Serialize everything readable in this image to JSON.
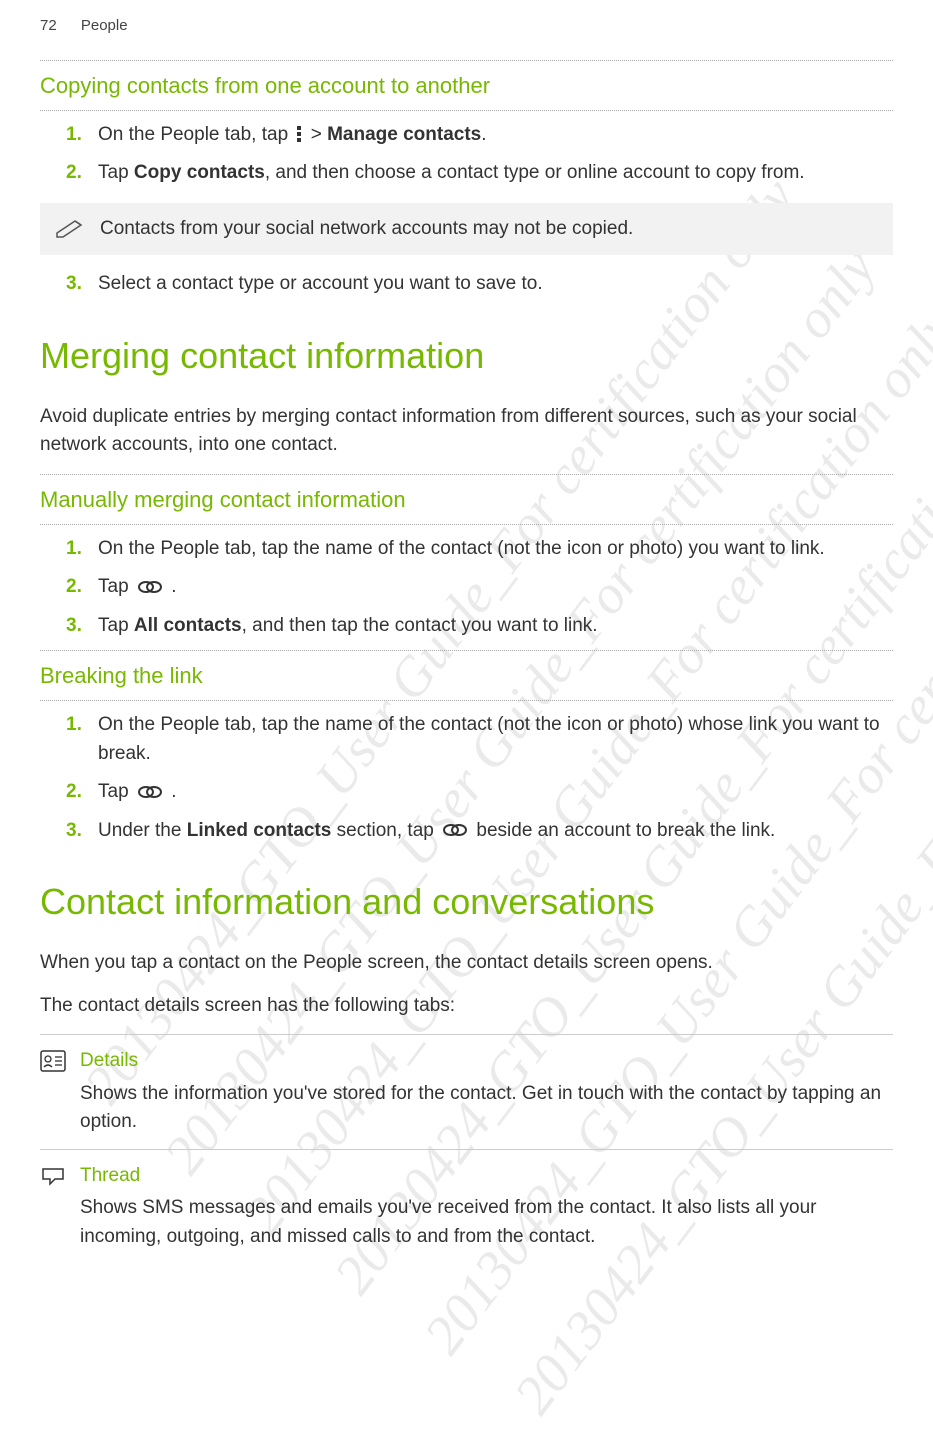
{
  "header": {
    "page_num": "72",
    "section": "People"
  },
  "section1": {
    "title": "Copying contacts from one account to another",
    "steps": {
      "n1": "1.",
      "t1a": "On the People tab, tap ",
      "t1b": " > ",
      "t1c": "Manage contacts",
      "t1d": ".",
      "n2": "2.",
      "t2a": "Tap ",
      "t2b": "Copy contacts",
      "t2c": ", and then choose a contact type or online account to copy from.",
      "n3": "3.",
      "t3": "Select a contact type or account you want to save to."
    },
    "tip": "Contacts from your social network accounts may not be copied."
  },
  "section2": {
    "title": "Merging contact information",
    "intro": "Avoid duplicate entries by merging contact information from different sources, such as your social network accounts, into one contact.",
    "sub1": {
      "title": "Manually merging contact information",
      "n1": "1.",
      "t1": "On the People tab, tap the name of the contact (not the icon or photo) you want to link.",
      "n2": "2.",
      "t2a": "Tap ",
      "t2b": " .",
      "n3": "3.",
      "t3a": "Tap ",
      "t3b": "All contacts",
      "t3c": ", and then tap the contact you want to link."
    },
    "sub2": {
      "title": "Breaking the link",
      "n1": "1.",
      "t1": "On the People tab, tap the name of the contact (not the icon or photo) whose link you want to break.",
      "n2": "2.",
      "t2a": "Tap ",
      "t2b": " .",
      "n3": "3.",
      "t3a": "Under the ",
      "t3b": "Linked contacts",
      "t3c": " section, tap ",
      "t3d": " beside an account to break the link."
    }
  },
  "section3": {
    "title": "Contact information and conversations",
    "p1": "When you tap a contact on the People screen, the contact details screen opens.",
    "p2": "The contact details screen has the following tabs:",
    "tabs": {
      "details": {
        "title": "Details",
        "desc": "Shows the information you've stored for the contact. Get in touch with the contact by tapping an option."
      },
      "thread": {
        "title": "Thread",
        "desc": "Shows SMS messages and emails you've received from the contact. It also lists all your incoming, outgoing, and missed calls to and from the contact."
      }
    }
  },
  "watermark": "20130424_GTO_User Guide_For certification only"
}
